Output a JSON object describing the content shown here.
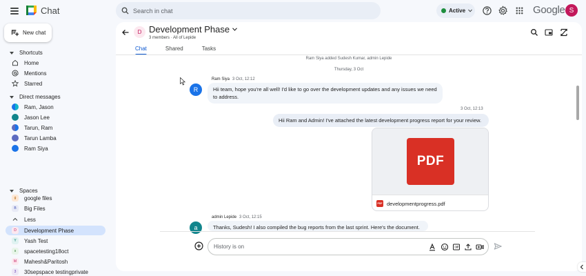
{
  "topbar": {
    "app_title": "Chat",
    "search_placeholder": "Search in chat",
    "status_label": "Active",
    "google_word": "Google",
    "account_initial": "S"
  },
  "sidebar": {
    "new_chat_label": "New chat",
    "shortcuts_heading": "Shortcuts",
    "shortcuts": [
      {
        "label": "Home",
        "icon": "home-icon"
      },
      {
        "label": "Mentions",
        "icon": "at-sign-icon"
      },
      {
        "label": "Starred",
        "icon": "star-icon"
      }
    ],
    "dm_heading": "Direct messages",
    "direct_messages": [
      {
        "label": "Ram, Jason"
      },
      {
        "label": "Jason Lee"
      },
      {
        "label": "Tarun, Ram"
      },
      {
        "label": "Tarun Lamba"
      },
      {
        "label": "Ram Siya"
      }
    ],
    "spaces_heading": "Spaces",
    "spaces": [
      {
        "label": "google files",
        "initial": "g"
      },
      {
        "label": "Big Files",
        "initial": "B"
      },
      {
        "label": "Less",
        "initial": ""
      },
      {
        "label": "Development Phase",
        "initial": "D"
      },
      {
        "label": "Yash Test",
        "initial": "Y"
      },
      {
        "label": "spacetesting18oct",
        "initial": "s"
      },
      {
        "label": "Mahesh&Paritosh",
        "initial": "M"
      },
      {
        "label": "30sepspace testingprivate",
        "initial": "3"
      }
    ]
  },
  "room": {
    "initial": "D",
    "title": "Development Phase",
    "members": "3 members",
    "scope": "All of Lepide",
    "tabs": [
      "Chat",
      "Shared",
      "Tasks"
    ]
  },
  "messages": {
    "system_note": "Ram Siya added Sudesh Kumar, admin Lepide",
    "date_divider": "Thursday, 3 Oct",
    "msg1": {
      "author": "Ram Siya",
      "time": "3 Oct, 12:12",
      "initial": "R",
      "text": "Hii team, hope you're all well! I'd like to go over the development updates and any issues we need to address."
    },
    "msg2": {
      "time": "3 Oct, 12:13",
      "text": "Hii Ram and Admin! I've attached the latest development progress report for your review."
    },
    "attachment": {
      "preview_label": "PDF",
      "icon_label": "PDF",
      "file_name": "developmentprogress.pdf"
    },
    "msg3": {
      "author": "admin Lepide",
      "time": "3 Oct, 12:15",
      "initial": "a",
      "text": "Thanks, Sudesh! I also compiled the bug reports from the last sprint. Here's the document."
    }
  },
  "composer": {
    "placeholder": "History is on"
  },
  "colors": {
    "accent": "#0b57d0",
    "active_green": "#1e8e3e",
    "selected_bg": "#d3e3fd",
    "pdf_red": "#d93025",
    "avatar_blue": "#1a73e8"
  }
}
